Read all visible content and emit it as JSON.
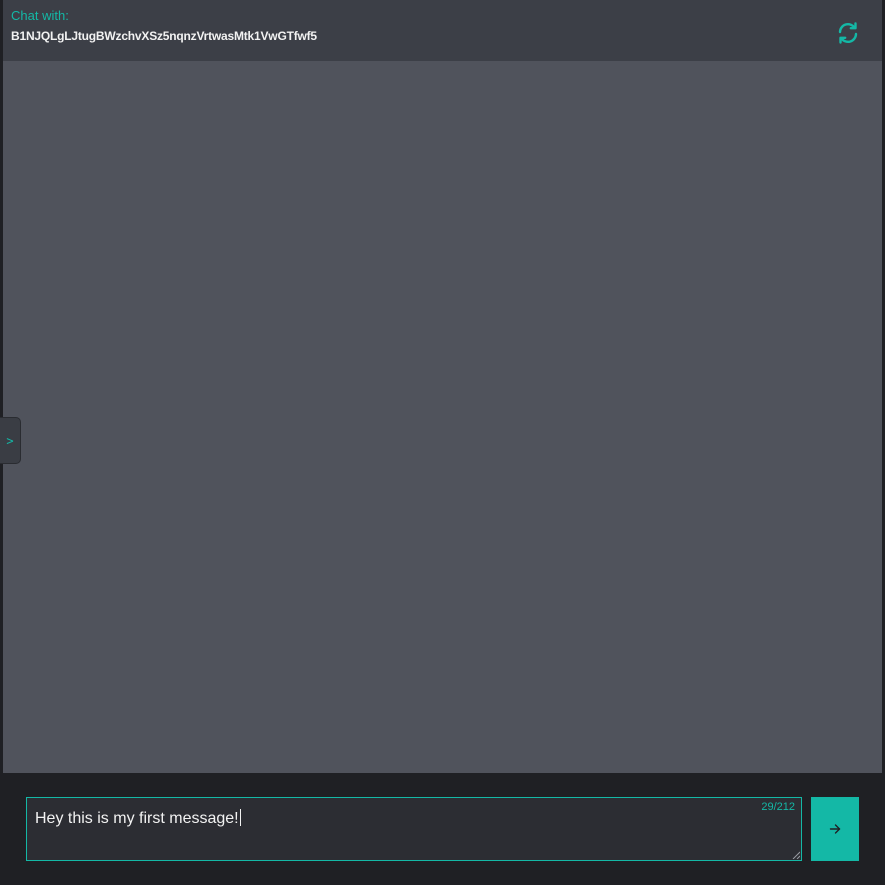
{
  "header": {
    "chat_with_label": "Chat with:",
    "chat_id": "B1NJQLgLJtugBWzchvXSz5nqnzVrtwasMtk1VwGTfwf5",
    "refresh_icon": "refresh-icon"
  },
  "sidebar": {
    "toggle_label": ">"
  },
  "composer": {
    "input_value": "Hey this is my first message!",
    "char_count": "29/212",
    "send_icon": "arrow-right-icon"
  },
  "colors": {
    "accent": "#14b8a6",
    "header_bg": "#3c3f47",
    "messages_bg": "#50535c",
    "composer_bg": "#1f2024",
    "input_bg": "#2c2d33"
  }
}
